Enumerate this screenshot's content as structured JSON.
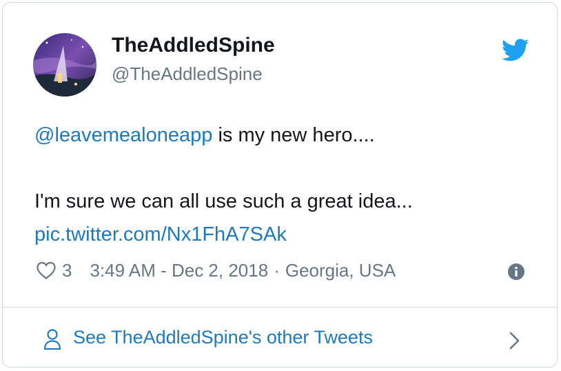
{
  "author": {
    "name": "TheAddledSpine",
    "handle": "@TheAddledSpine",
    "avatar_icon": "avatar-night-scene"
  },
  "tweet": {
    "mention": "@leavemealoneapp",
    "line1_rest": " is my new hero....",
    "line2": "I'm sure we can all  use such a great idea...",
    "media_link": "pic.twitter.com/Nx1FhA7SAk"
  },
  "meta": {
    "like_icon": "heart-icon",
    "likes": "3",
    "timestamp": "3:49 AM - Dec 2, 2018",
    "separator": "·",
    "location": "Georgia, USA",
    "info_icon": "info-icon"
  },
  "footer": {
    "label": "See TheAddledSpine's other Tweets",
    "user_icon": "person-icon",
    "chevron_icon": "chevron-right-icon"
  },
  "colors": {
    "link": "#1b7ac2",
    "twitter_blue": "#1da1f2",
    "text": "#14171a",
    "muted": "#657786",
    "border": "#cfd9de"
  }
}
